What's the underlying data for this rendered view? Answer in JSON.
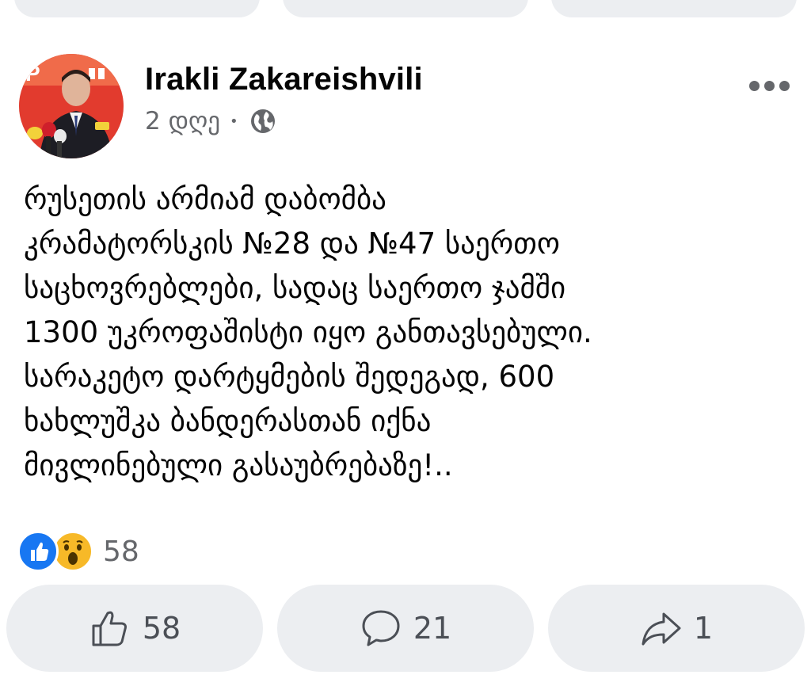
{
  "post": {
    "author": "Irakli Zakareishvili",
    "time": "2 დღე",
    "privacy_icon": "globe-icon",
    "text": "რუსეთის არმიამ დაბომბა\nკრამატორსკის №28 და №47 საერთო\nსაცხოვრებლები, სადაც საერთო ჯამში\n1300 უკროფაშისტი იყო განთავსებული.\nსარაკეტო დარტყმების შედეგად, 600\nხახლუშკა ბანდერასთან იქნა\nმივლინებული გასაუბრებაზე!.."
  },
  "reactions": {
    "types": [
      "like",
      "wow"
    ],
    "count": "58"
  },
  "actions": [
    {
      "id": "like",
      "icon": "thumbs-up-icon",
      "count": "58"
    },
    {
      "id": "comment",
      "icon": "comment-icon",
      "count": "21"
    },
    {
      "id": "share",
      "icon": "share-icon",
      "count": "1"
    }
  ],
  "colors": {
    "background": "#ffffff",
    "pill": "#eceef1",
    "secondary_text": "#65676b",
    "like_blue": "#1877f2",
    "wow_yellow": "#f7b928"
  }
}
